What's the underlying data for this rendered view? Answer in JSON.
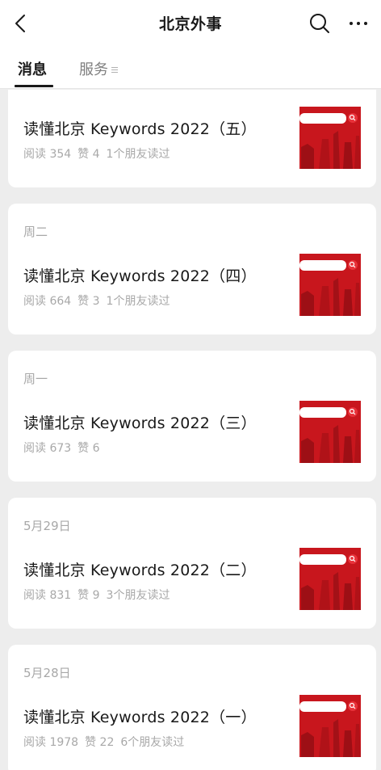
{
  "header": {
    "title": "北京外事"
  },
  "tabs": [
    {
      "label": "消息",
      "active": true
    },
    {
      "label": "服务",
      "active": false
    }
  ],
  "articles": [
    {
      "date": "",
      "title": "读懂北京 Keywords 2022（五）",
      "reads": "阅读 354",
      "likes": "赞 4",
      "friends": "1个朋友读过"
    },
    {
      "date": "周二",
      "title": "读懂北京 Keywords 2022（四）",
      "reads": "阅读 664",
      "likes": "赞 3",
      "friends": "1个朋友读过"
    },
    {
      "date": "周一",
      "title": "读懂北京 Keywords 2022（三）",
      "reads": "阅读 673",
      "likes": "赞 6",
      "friends": ""
    },
    {
      "date": "5月29日",
      "title": "读懂北京 Keywords 2022（二）",
      "reads": "阅读 831",
      "likes": "赞 9",
      "friends": "3个朋友读过"
    },
    {
      "date": "5月28日",
      "title": "读懂北京 Keywords 2022（一）",
      "reads": "阅读 1978",
      "likes": "赞 22",
      "friends": "6个朋友读过"
    }
  ],
  "colors": {
    "thumbnail_red": "#c8161d",
    "meta_gray": "#a8a8a8",
    "text": "#191919"
  },
  "icons": [
    "back-arrow-icon",
    "search-icon",
    "more-icon",
    "menu-lines-icon"
  ]
}
